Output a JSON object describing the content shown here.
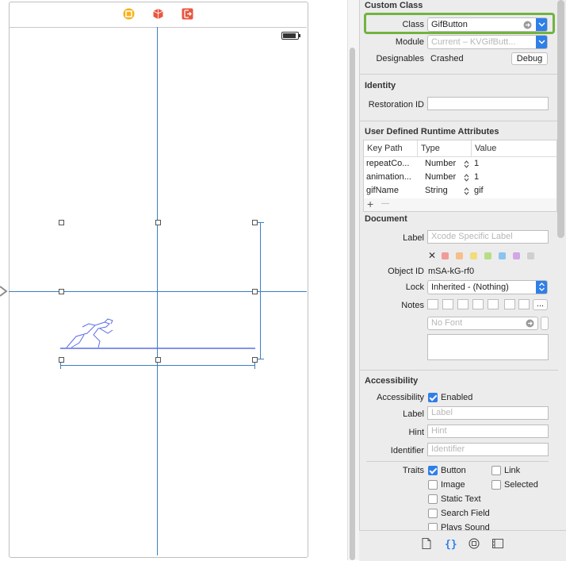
{
  "canvas": {
    "dock_icons": [
      "view-controller-icon",
      "first-responder-icon",
      "exit-icon"
    ]
  },
  "inspector": {
    "custom_class": {
      "title": "Custom Class",
      "class_label": "Class",
      "class_value": "GifButton",
      "module_label": "Module",
      "module_placeholder": "Current – KVGifButt...",
      "designables_label": "Designables",
      "designables_value": "Crashed",
      "debug_button": "Debug"
    },
    "identity": {
      "title": "Identity",
      "restoration_id_label": "Restoration ID",
      "restoration_id_value": ""
    },
    "runtime_attributes": {
      "title": "User Defined Runtime Attributes",
      "headers": [
        "Key Path",
        "Type",
        "Value"
      ],
      "rows": [
        {
          "key": "repeatCo...",
          "type": "Number",
          "value": "1"
        },
        {
          "key": "animation...",
          "type": "Number",
          "value": "1"
        },
        {
          "key": "gifName",
          "type": "String",
          "value": "gif"
        }
      ],
      "add": "+",
      "remove": "—"
    },
    "document": {
      "title": "Document",
      "label_label": "Label",
      "label_placeholder": "Xcode Specific Label",
      "clear_color": "✕",
      "swatches": [
        "#f29b9b",
        "#f5bf8a",
        "#f1dc7e",
        "#b9dc86",
        "#8cc3ef",
        "#d2a8e4",
        "#cfcfcf"
      ],
      "object_id_label": "Object ID",
      "object_id_value": "mSA-kG-rf0",
      "lock_label": "Lock",
      "lock_value": "Inherited - (Nothing)",
      "notes_label": "Notes",
      "font_placeholder": "No Font",
      "notes_more": "..."
    },
    "accessibility": {
      "title": "Accessibility",
      "accessibility_label": "Accessibility",
      "enabled_label": "Enabled",
      "enabled": true,
      "label_label": "Label",
      "label_placeholder": "Label",
      "hint_label": "Hint",
      "hint_placeholder": "Hint",
      "identifier_label": "Identifier",
      "identifier_placeholder": "Identifier",
      "traits_label": "Traits",
      "traits": [
        {
          "name": "Button",
          "checked": true
        },
        {
          "name": "Link",
          "checked": false
        },
        {
          "name": "Image",
          "checked": false
        },
        {
          "name": "Selected",
          "checked": false
        },
        {
          "name": "Static Text",
          "checked": false
        },
        {
          "name": "Search Field",
          "checked": false
        },
        {
          "name": "Plays Sound",
          "checked": false
        }
      ]
    },
    "bottom_tabs": [
      "file-template-icon",
      "code-snippet-icon",
      "object-library-icon",
      "media-library-icon"
    ],
    "accent_color": "#2f7fe8",
    "highlight_color": "#72b340"
  }
}
